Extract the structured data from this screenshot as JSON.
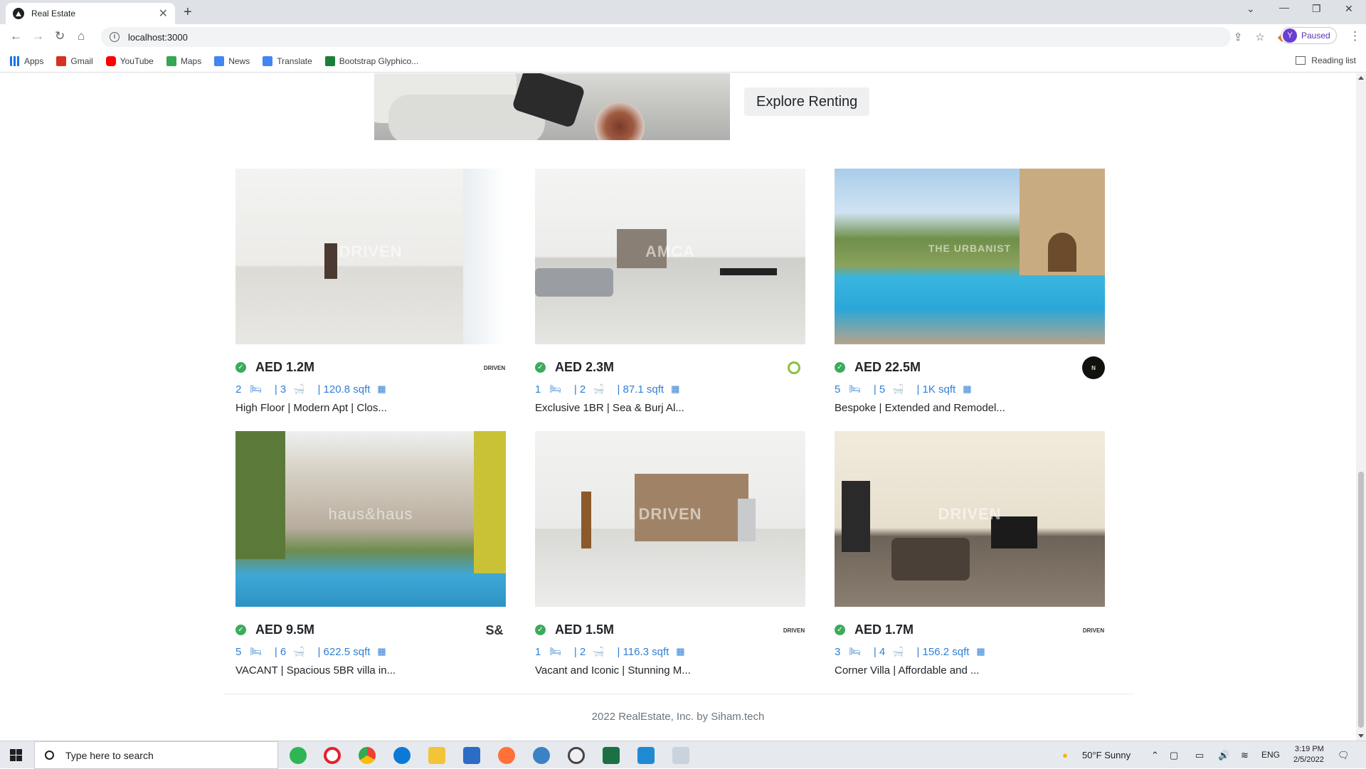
{
  "browser": {
    "tab_title": "Real Estate",
    "url": "localhost:3000",
    "profile_initial": "Y",
    "profile_status": "Paused",
    "reading_list": "Reading list",
    "bookmarks": [
      {
        "label": "Apps",
        "color": "#1a73e8"
      },
      {
        "label": "Gmail",
        "color": "#d93025"
      },
      {
        "label": "YouTube",
        "color": "#ff0000"
      },
      {
        "label": "Maps",
        "color": "#34a853"
      },
      {
        "label": "News",
        "color": "#4285f4"
      },
      {
        "label": "Translate",
        "color": "#4285f4"
      },
      {
        "label": "Bootstrap Glyphico...",
        "color": "#188038"
      }
    ]
  },
  "page": {
    "explore_button": "Explore Renting",
    "footer": "2022 RealEstate, Inc. by Siham.tech",
    "listings": [
      {
        "price": "AED 1.2M",
        "beds": "2",
        "baths": "| 3",
        "area": "| 120.8 sqft",
        "title": "High Floor | Modern Apt | Clos...",
        "agency": "DRIVEN",
        "watermark": "DRIVEN"
      },
      {
        "price": "AED 2.3M",
        "beds": "1",
        "baths": "| 2",
        "area": "| 87.1 sqft",
        "title": "Exclusive 1BR | Sea & Burj Al...",
        "agency": "",
        "watermark": "AMCA"
      },
      {
        "price": "AED 22.5M",
        "beds": "5",
        "baths": "| 5",
        "area": "| 1K sqft",
        "title": "Bespoke | Extended and Remodel...",
        "agency": "",
        "watermark": "THE URBANIST"
      },
      {
        "price": "AED 9.5M",
        "beds": "5",
        "baths": "| 6",
        "area": "| 622.5 sqft",
        "title": "VACANT | Spacious 5BR villa in...",
        "agency": "",
        "watermark": "haus&haus"
      },
      {
        "price": "AED 1.5M",
        "beds": "1",
        "baths": "| 2",
        "area": "| 116.3 sqft",
        "title": "Vacant and Iconic | Stunning M...",
        "agency": "DRIVEN",
        "watermark": "DRIVEN"
      },
      {
        "price": "AED 1.7M",
        "beds": "3",
        "baths": "| 4",
        "area": "| 156.2 sqft",
        "title": "Corner Villa | Affordable and ...",
        "agency": "DRIVEN",
        "watermark": "DRIVEN"
      }
    ]
  },
  "taskbar": {
    "search_placeholder": "Type here to search",
    "weather": "50°F  Sunny",
    "lang": "ENG",
    "time": "3:19 PM",
    "date": "2/5/2022"
  }
}
